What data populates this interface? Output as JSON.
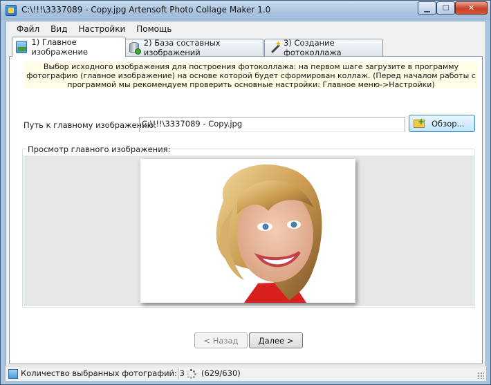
{
  "window": {
    "title": "C:\\!!!\\3337089 - Copy.jpg Artensoft Photo Collage Maker 1.0",
    "minimize_label": "▁",
    "maximize_label": "☐",
    "close_label": "✕"
  },
  "menu": {
    "items": [
      "Файл",
      "Вид",
      "Настройки",
      "Помощь"
    ]
  },
  "tabs": [
    {
      "label": "1) Главное изображение",
      "icon": "image-icon",
      "active": true
    },
    {
      "label": "2) База составных изображений",
      "icon": "database-icon",
      "active": false
    },
    {
      "label": "3) Создание фотоколлажа",
      "icon": "magic-wand-icon",
      "active": false
    }
  ],
  "main": {
    "info_text": "Выбор исходного изображения для построения фотоколлажа: на первом шаге загрузите в программу фотографию (главное изображение) на основе которой будет сформирован коллаж. (Перед началом работы с программой мы рекомендуем проверить основные настройки: Главное меню->Настройки)",
    "path_label": "Путь к главному изображению:",
    "path_value": "C:\\!!!\\3337089 - Copy.jpg",
    "browse_label": "Обзор...",
    "preview_legend": "Просмотр главного изображения:",
    "back_label": "< Назад",
    "next_label": "Далее >"
  },
  "status": {
    "count_text": "Количество выбранных фотографий: 3",
    "progress_text": "(629/630)"
  },
  "colors": {
    "accent": "#3c7fb1",
    "info_bg": "#fffde6",
    "preview_bg": "#e6e6e6"
  }
}
